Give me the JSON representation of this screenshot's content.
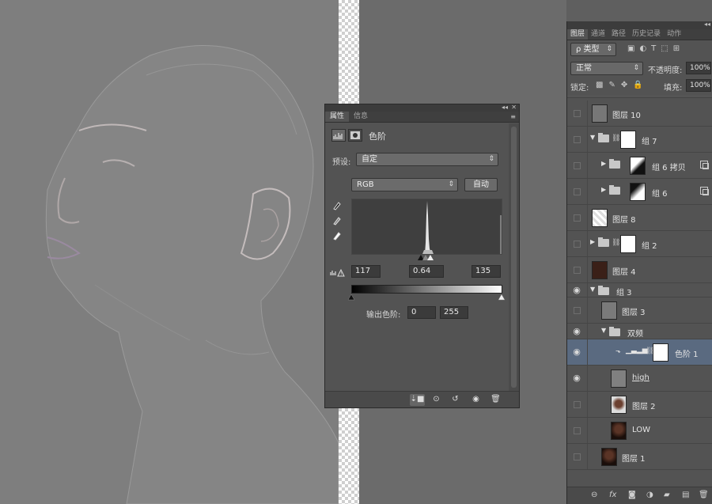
{
  "properties_panel": {
    "tabs": [
      "属性",
      "信息"
    ],
    "title": "色阶",
    "preset_label": "预设:",
    "preset_value": "自定",
    "channel_value": "RGB",
    "auto_label": "自动",
    "input_black": "117",
    "input_gamma": "0.64",
    "input_white": "135",
    "output_label": "输出色阶:",
    "output_black": "0",
    "output_white": "255"
  },
  "layers_panel": {
    "tabs": [
      "图层",
      "通道",
      "路径",
      "历史记录",
      "动作"
    ],
    "filter_label": "ρ 类型",
    "blend_mode": "正常",
    "opacity_label": "不透明度:",
    "opacity_value": "100%",
    "lock_label": "锁定:",
    "fill_label": "填充:",
    "fill_value": "100%",
    "layers": [
      {
        "name": "图层 10",
        "visible": false
      },
      {
        "name": "组 7",
        "visible": false
      },
      {
        "name": "组 6 拷贝",
        "visible": false
      },
      {
        "name": "组 6",
        "visible": false
      },
      {
        "name": "图层 8",
        "visible": false
      },
      {
        "name": "组 2",
        "visible": false
      },
      {
        "name": "图层 4",
        "visible": false
      },
      {
        "name": "组 3",
        "visible": true
      },
      {
        "name": "图层 3",
        "visible": false
      },
      {
        "name": "双频",
        "visible": true
      },
      {
        "name": "色阶 1",
        "visible": true,
        "selected": true
      },
      {
        "name": "high",
        "visible": true
      },
      {
        "name": "图层 2",
        "visible": false
      },
      {
        "name": "LOW",
        "visible": false
      },
      {
        "name": "图层 1",
        "visible": false
      }
    ],
    "footer_icons": [
      "link-icon",
      "fx-icon",
      "mask-icon",
      "adjustment-icon",
      "group-icon",
      "new-layer-icon",
      "delete-icon"
    ]
  }
}
